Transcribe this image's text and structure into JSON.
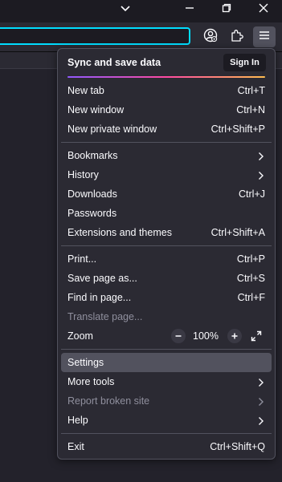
{
  "titlebar": {
    "buttons": [
      {
        "name": "list-all-tabs-icon"
      },
      {
        "name": "minimize-icon"
      },
      {
        "name": "restore-icon"
      },
      {
        "name": "close-icon"
      }
    ]
  },
  "toolbar": {
    "buttons": [
      {
        "name": "account-icon"
      },
      {
        "name": "extensions-icon"
      },
      {
        "name": "hamburger-menu-icon"
      }
    ]
  },
  "menu": {
    "sync": {
      "title": "Sync and save data",
      "sign_in": "Sign In"
    },
    "items": [
      {
        "label": "New tab",
        "shortcut": "Ctrl+T"
      },
      {
        "label": "New window",
        "shortcut": "Ctrl+N"
      },
      {
        "label": "New private window",
        "shortcut": "Ctrl+Shift+P"
      },
      {
        "label": "Bookmarks",
        "shortcut": ""
      },
      {
        "label": "History",
        "shortcut": ""
      },
      {
        "label": "Downloads",
        "shortcut": "Ctrl+J"
      },
      {
        "label": "Passwords",
        "shortcut": ""
      },
      {
        "label": "Extensions and themes",
        "shortcut": "Ctrl+Shift+A"
      },
      {
        "label": "Print...",
        "shortcut": "Ctrl+P"
      },
      {
        "label": "Save page as...",
        "shortcut": "Ctrl+S"
      },
      {
        "label": "Find in page...",
        "shortcut": "Ctrl+F"
      },
      {
        "label": "Translate page...",
        "shortcut": ""
      },
      {
        "label": "Zoom",
        "shortcut": ""
      },
      {
        "label": "Settings",
        "shortcut": ""
      },
      {
        "label": "More tools",
        "shortcut": ""
      },
      {
        "label": "Report broken site",
        "shortcut": ""
      },
      {
        "label": "Help",
        "shortcut": ""
      },
      {
        "label": "Exit",
        "shortcut": "Ctrl+Shift+Q"
      }
    ],
    "zoom": {
      "minus": "−",
      "value": "100%",
      "plus": "+"
    }
  },
  "colors": {
    "accent": "#00ddff",
    "menu_bg": "#2b2a33",
    "hover_bg": "#52525e",
    "disabled_text": "#8f8f9d"
  }
}
